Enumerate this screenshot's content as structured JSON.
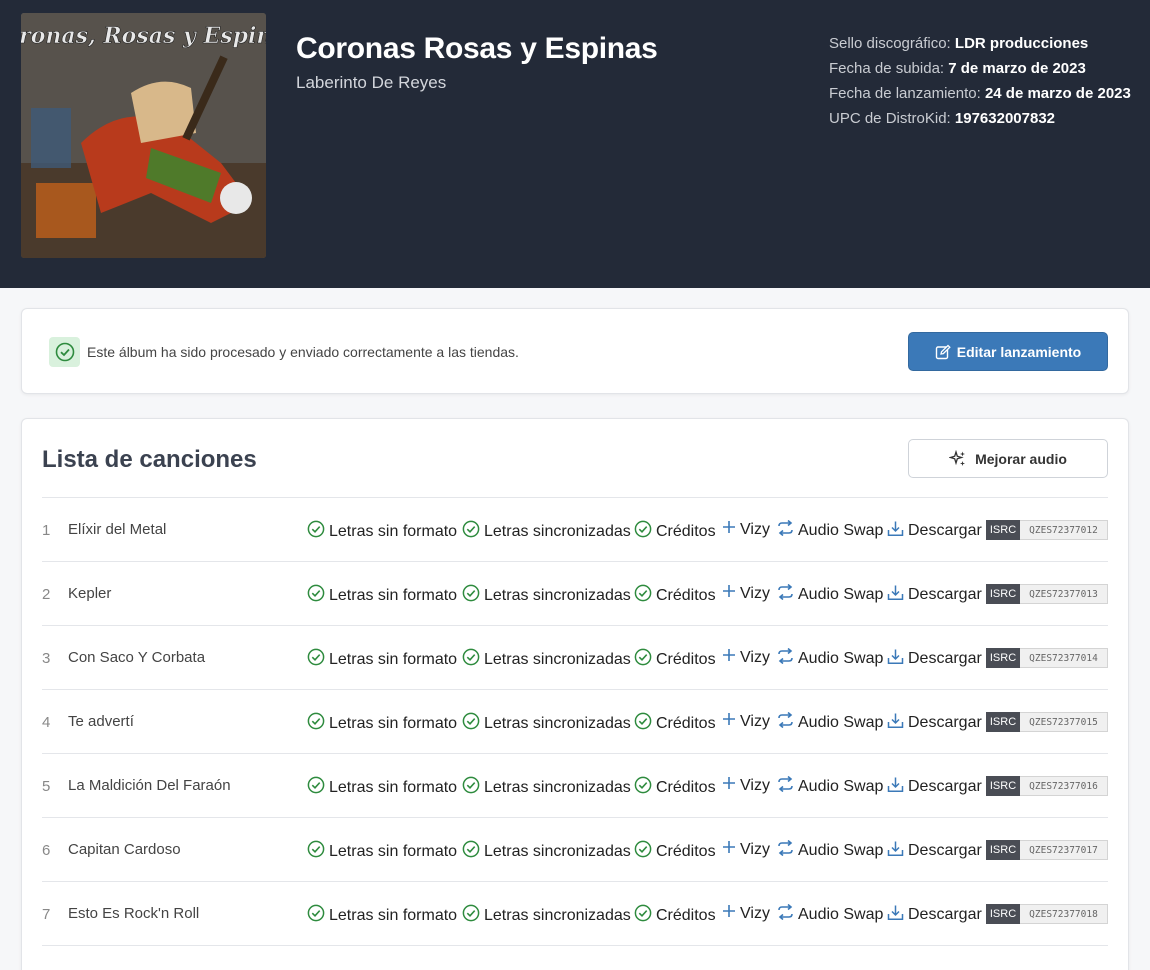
{
  "album": {
    "title": "Coronas Rosas y Espinas",
    "artist": "Laberinto De Reyes",
    "cover_text": "Coronas, Rosas y Espinas"
  },
  "meta": {
    "label_key": "Sello discográfico:",
    "label_value": "LDR producciones",
    "upload_key": "Fecha de subida:",
    "upload_value": "7 de marzo de 2023",
    "release_key": "Fecha de lanzamiento:",
    "release_value": "24 de marzo de 2023",
    "upc_key": "UPC de DistroKid:",
    "upc_value": "197632007832"
  },
  "notice": {
    "text": "Este álbum ha sido procesado y enviado correctamente a las tiendas.",
    "edit_label": "Editar lanzamiento"
  },
  "tracklist": {
    "title": "Lista de canciones",
    "improve_label": "Mejorar audio",
    "actions": {
      "lyrics": "Letras sin formato",
      "synced": "Letras sincronizadas",
      "credits": "Créditos",
      "vizy": "Vizy",
      "swap": "Audio Swap",
      "download": "Descargar",
      "isrc_label": "ISRC"
    },
    "tracks": [
      {
        "num": "1",
        "name": "Elíxir del Metal",
        "isrc": "QZES72377012"
      },
      {
        "num": "2",
        "name": "Kepler",
        "isrc": "QZES72377013"
      },
      {
        "num": "3",
        "name": "Con Saco Y Corbata",
        "isrc": "QZES72377014"
      },
      {
        "num": "4",
        "name": "Te advertí",
        "isrc": "QZES72377015"
      },
      {
        "num": "5",
        "name": "La Maldición Del Faraón",
        "isrc": "QZES72377016"
      },
      {
        "num": "6",
        "name": "Capitan Cardoso",
        "isrc": "QZES72377017"
      },
      {
        "num": "7",
        "name": "Esto Es Rock'n Roll",
        "isrc": "QZES72377018"
      }
    ]
  },
  "colors": {
    "header_bg": "#232a38",
    "primary_button": "#3b79b8",
    "check_green": "#2e8b3e",
    "action_blue": "#3b79b8"
  }
}
